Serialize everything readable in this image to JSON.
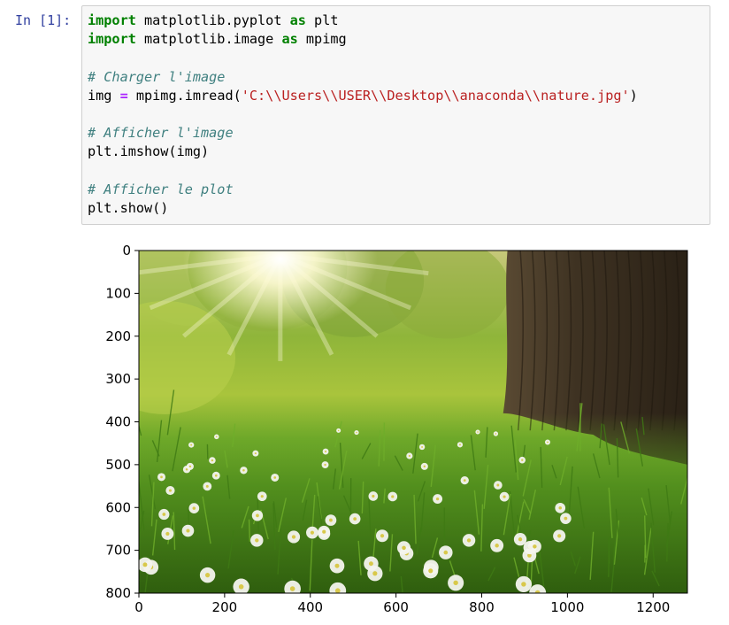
{
  "cell": {
    "prompt": "In [1]:",
    "lines": [
      [
        {
          "c": "kw",
          "t": "import"
        },
        {
          "c": "",
          "t": " matplotlib.pyplot "
        },
        {
          "c": "kw",
          "t": "as"
        },
        {
          "c": "",
          "t": " plt"
        }
      ],
      [
        {
          "c": "kw",
          "t": "import"
        },
        {
          "c": "",
          "t": " matplotlib.image "
        },
        {
          "c": "kw",
          "t": "as"
        },
        {
          "c": "",
          "t": " mpimg"
        }
      ],
      [],
      [
        {
          "c": "cm",
          "t": "# Charger l'image"
        }
      ],
      [
        {
          "c": "",
          "t": "img "
        },
        {
          "c": "op",
          "t": "="
        },
        {
          "c": "",
          "t": " mpimg.imread("
        },
        {
          "c": "st",
          "t": "'C:\\\\Users\\\\USER\\\\Desktop\\\\anaconda\\\\nature.jpg'"
        },
        {
          "c": "",
          "t": ")"
        }
      ],
      [],
      [
        {
          "c": "cm",
          "t": "# Afficher l'image"
        }
      ],
      [
        {
          "c": "",
          "t": "plt.imshow(img)"
        }
      ],
      [],
      [
        {
          "c": "cm",
          "t": "# Afficher le plot"
        }
      ],
      [
        {
          "c": "",
          "t": "plt.show()"
        }
      ]
    ]
  },
  "chart_data": {
    "type": "image",
    "image_size": [
      1280,
      800
    ],
    "xlim": [
      0,
      1280
    ],
    "ylim": [
      800,
      0
    ],
    "xticks": [
      0,
      200,
      400,
      600,
      800,
      1000,
      1200
    ],
    "yticks": [
      0,
      100,
      200,
      300,
      400,
      500,
      600,
      700,
      800
    ],
    "image_content": "nature photo: sunlit green meadow with white flowers and a tree trunk on the right"
  },
  "colors": {
    "sky_light": "#fffbd6",
    "foliage": "#8fb53a",
    "grass": "#4f8f1c",
    "grass_dark": "#2f5e0e",
    "trunk": "#3e3222",
    "flower": "#f4f4ee"
  }
}
